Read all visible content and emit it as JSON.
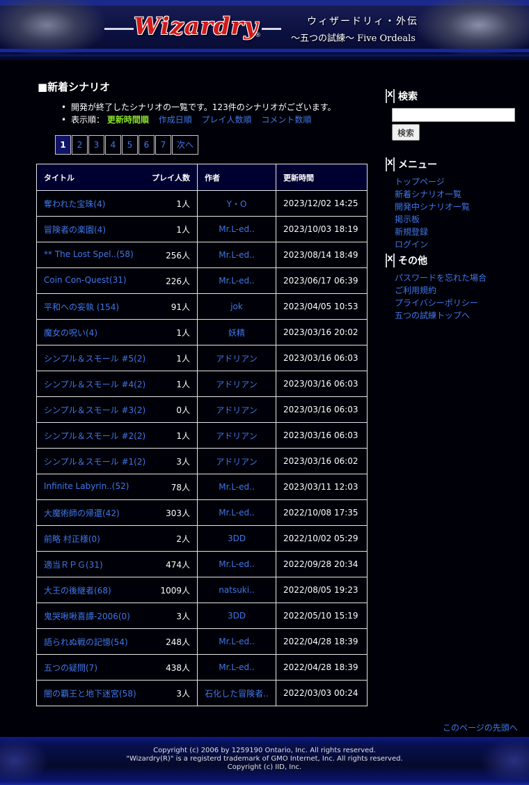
{
  "header": {
    "logo_text": "Wizardry",
    "logo_mark": "®",
    "subtitle_1": "ウィザードリィ・外伝",
    "subtitle_2": "〜五つの試練〜 Five Ordeals"
  },
  "main": {
    "heading": "■新着シナリオ",
    "description": "開発が終了したシナリオの一覧です。123件のシナリオがございます。",
    "sort_label": "表示順：",
    "sort_options": [
      "更新時間順",
      "作成日順",
      "プレイ人数順",
      "コメント数順"
    ],
    "pages": [
      "1",
      "2",
      "3",
      "4",
      "5",
      "6",
      "7"
    ],
    "next_label": "次へ",
    "current_page": 1,
    "table": {
      "headers": {
        "title": "タイトル",
        "plays": "プレイ人数",
        "author": "作者",
        "updated": "更新時間"
      },
      "rows": [
        {
          "title": "奪われた宝珠(4)",
          "plays": "1人",
          "author": "Y・O",
          "updated": "2023/12/02 14:25"
        },
        {
          "title": "冒険者の楽園(4)",
          "plays": "1人",
          "author": "Mr.L-ed..",
          "updated": "2023/10/03 18:19"
        },
        {
          "title": "** The Lost Spel..(58)",
          "plays": "256人",
          "author": "Mr.L-ed..",
          "updated": "2023/08/14 18:49"
        },
        {
          "title": "Coin Con-Quest(31)",
          "plays": "226人",
          "author": "Mr.L-ed..",
          "updated": "2023/06/17 06:39"
        },
        {
          "title": "平和への妄執 (154)",
          "plays": "91人",
          "author": "jok",
          "updated": "2023/04/05 10:53"
        },
        {
          "title": "魔女の呪い(4)",
          "plays": "1人",
          "author": "妖精",
          "updated": "2023/03/16 20:02"
        },
        {
          "title": "シンプル＆スモール #5(2)",
          "plays": "1人",
          "author": "アドリアン",
          "updated": "2023/03/16 06:03"
        },
        {
          "title": "シンプル＆スモール #4(2)",
          "plays": "1人",
          "author": "アドリアン",
          "updated": "2023/03/16 06:03"
        },
        {
          "title": "シンプル＆スモール #3(2)",
          "plays": "0人",
          "author": "アドリアン",
          "updated": "2023/03/16 06:03"
        },
        {
          "title": "シンプル＆スモール #2(2)",
          "plays": "1人",
          "author": "アドリアン",
          "updated": "2023/03/16 06:03"
        },
        {
          "title": "シンプル＆スモール #1(2)",
          "plays": "3人",
          "author": "アドリアン",
          "updated": "2023/03/16 06:02"
        },
        {
          "title": "Infinite Labyrin..(52)",
          "plays": "78人",
          "author": "Mr.L-ed..",
          "updated": "2023/03/11 12:03"
        },
        {
          "title": "大魔術師の帰還(42)",
          "plays": "303人",
          "author": "Mr.L-ed..",
          "updated": "2022/10/08 17:35"
        },
        {
          "title": "前略 村正様(0)",
          "plays": "2人",
          "author": "3DD",
          "updated": "2022/10/02 05:29"
        },
        {
          "title": "適当ＲＰＧ(31)",
          "plays": "474人",
          "author": "Mr.L-ed..",
          "updated": "2022/09/28 20:34"
        },
        {
          "title": "大王の後継者(68)",
          "plays": "1009人",
          "author": "natsuki..",
          "updated": "2022/08/05 19:23"
        },
        {
          "title": "鬼哭啾啾喜譚-2006(0)",
          "plays": "3人",
          "author": "3DD",
          "updated": "2022/05/10 15:19"
        },
        {
          "title": "語られぬ戦の記憶(54)",
          "plays": "248人",
          "author": "Mr.L-ed..",
          "updated": "2022/04/28 18:39"
        },
        {
          "title": "五つの疑問(7)",
          "plays": "438人",
          "author": "Mr.L-ed..",
          "updated": "2022/04/28 18:39"
        },
        {
          "title": "闇の覇王と地下迷宮(58)",
          "plays": "3人",
          "author": "石化した冒険者..",
          "updated": "2022/03/03 00:24"
        }
      ]
    },
    "page_top_link": "このページの先頭へ"
  },
  "sidebar": {
    "search_title": "検索",
    "search_button": "検索",
    "search_value": "",
    "menu_title": "メニュー",
    "menu_items": [
      "トップページ",
      "新着シナリオ一覧",
      "開発中シナリオ一覧",
      "掲示板",
      "新規登録",
      "ログイン"
    ],
    "other_title": "その他",
    "other_items": [
      "パスワードを忘れた場合",
      "ご利用規約",
      "プライバシーポリシー",
      "五つの試練トップへ"
    ]
  },
  "footer": {
    "lines": [
      "Copyright (c) 2006 by 1259190 Ontario, Inc. All rights reserved.",
      "\"Wizardry(R)\" is a registerd trademark of GMO Internet, Inc. All rights reserved.",
      "Copyright (c) IID, Inc."
    ]
  },
  "colors": {
    "background": "#000008",
    "link": "#3f78e8",
    "active_sort": "#8be02a",
    "logo_red": "#d21a1a",
    "table_header_bg": "#000030",
    "current_page_bg": "#101466"
  }
}
